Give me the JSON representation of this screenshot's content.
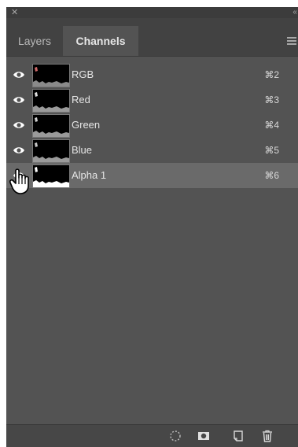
{
  "window": {
    "close_glyph": "✕",
    "collapse_glyph": "‹‹"
  },
  "tabs": [
    {
      "label": "Layers",
      "active": false
    },
    {
      "label": "Channels",
      "active": true
    }
  ],
  "channels": [
    {
      "label": "RGB",
      "shortcut": "⌘2",
      "visible": true,
      "selected": false
    },
    {
      "label": "Red",
      "shortcut": "⌘3",
      "visible": true,
      "selected": false
    },
    {
      "label": "Green",
      "shortcut": "⌘4",
      "visible": true,
      "selected": false
    },
    {
      "label": "Blue",
      "shortcut": "⌘5",
      "visible": true,
      "selected": false
    },
    {
      "label": "Alpha 1",
      "shortcut": "⌘6",
      "visible": true,
      "selected": true
    }
  ],
  "bottom_icons": [
    "load-selection-icon",
    "save-selection-mask-icon",
    "new-channel-icon",
    "trash-icon"
  ],
  "colors": {
    "panel_bg": "#535353",
    "tabbar_bg": "#424242",
    "selected_row": "#6a6a6a",
    "text": "#e6e6e6"
  }
}
